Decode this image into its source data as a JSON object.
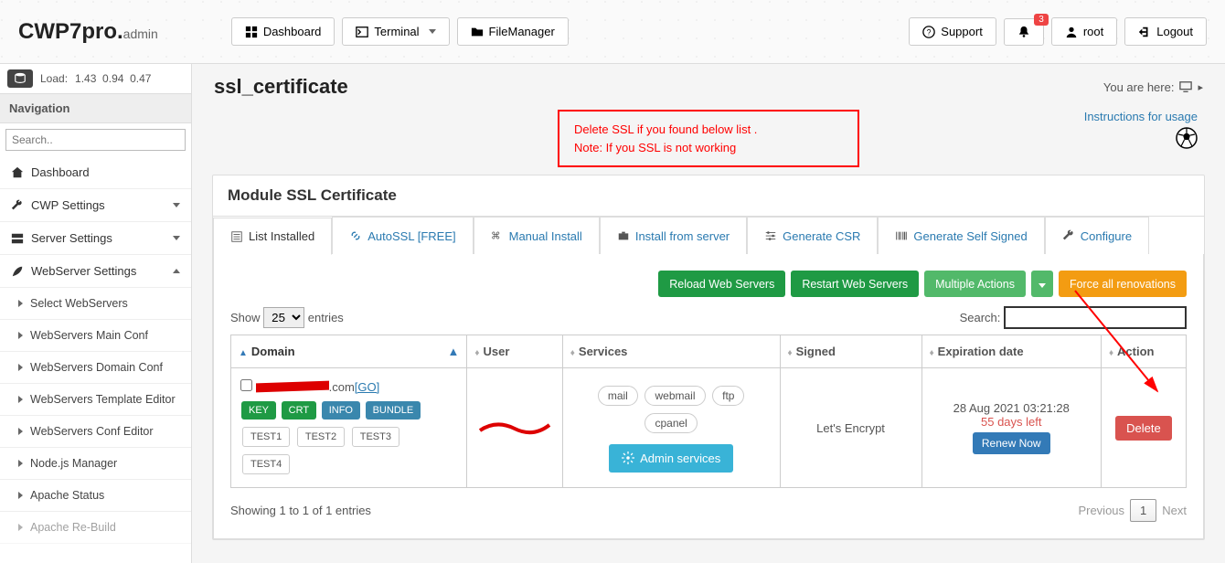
{
  "logo": {
    "main": "CWP7pro.",
    "sub": "admin"
  },
  "topbar": {
    "dashboard": "Dashboard",
    "terminal": "Terminal",
    "filemanager": "FileManager",
    "support": "Support",
    "notif_count": "3",
    "user": "root",
    "logout": "Logout"
  },
  "load": {
    "label": "Load:",
    "values": "1.43  0.94  0.47"
  },
  "nav": {
    "header": "Navigation",
    "search_placeholder": "Search..",
    "items": [
      {
        "label": "Dashboard",
        "icon": "home"
      },
      {
        "label": "CWP Settings",
        "icon": "wrench",
        "caret": true
      },
      {
        "label": "Server Settings",
        "icon": "server",
        "caret": true
      },
      {
        "label": "WebServer Settings",
        "icon": "feather",
        "caret": true,
        "expanded": true
      }
    ],
    "sub": [
      "Select WebServers",
      "WebServers Main Conf",
      "WebServers Domain Conf",
      "WebServers Template Editor",
      "WebServers Conf Editor",
      "Node.js Manager",
      "Apache Status",
      "Apache Re-Build"
    ]
  },
  "page": {
    "title": "ssl_certificate",
    "breadcrumb": "You are here:"
  },
  "note": {
    "l1": "Delete SSL if you found below list .",
    "l2": "Note: If you SSL is not working"
  },
  "instructions": "Instructions for usage",
  "panel": {
    "title": "Module SSL Certificate"
  },
  "tabs": [
    {
      "label": "List Installed",
      "active": true
    },
    {
      "label": "AutoSSL [FREE]"
    },
    {
      "label": "Manual Install"
    },
    {
      "label": "Install from server"
    },
    {
      "label": "Generate CSR"
    },
    {
      "label": "Generate Self Signed"
    },
    {
      "label": "Configure"
    }
  ],
  "actions": {
    "reload": "Reload Web Servers",
    "restart": "Restart Web Servers",
    "multiple": "Multiple Actions",
    "force": "Force all renovations"
  },
  "dt": {
    "show": "Show",
    "entries": "entries",
    "len": "25",
    "search": "Search:",
    "info": "Showing 1 to 1 of 1 entries",
    "prev": "Previous",
    "next": "Next",
    "page": "1"
  },
  "cols": {
    "domain": "Domain",
    "user": "User",
    "services": "Services",
    "signed": "Signed",
    "exp": "Expiration date",
    "action": "Action"
  },
  "row": {
    "domain_suffix": ".com",
    "go": "[GO]",
    "key": "KEY",
    "crt": "CRT",
    "info": "INFO",
    "bundle": "BUNDLE",
    "t1": "TEST1",
    "t2": "TEST2",
    "t3": "TEST3",
    "t4": "TEST4",
    "svc_mail": "mail",
    "svc_webmail": "webmail",
    "svc_ftp": "ftp",
    "svc_cpanel": "cpanel",
    "admin": "Admin services",
    "signed": "Let's Encrypt",
    "exp_date": "28 Aug 2021 03:21:28",
    "days_left": "55 days left",
    "renew": "Renew Now",
    "delete": "Delete"
  }
}
